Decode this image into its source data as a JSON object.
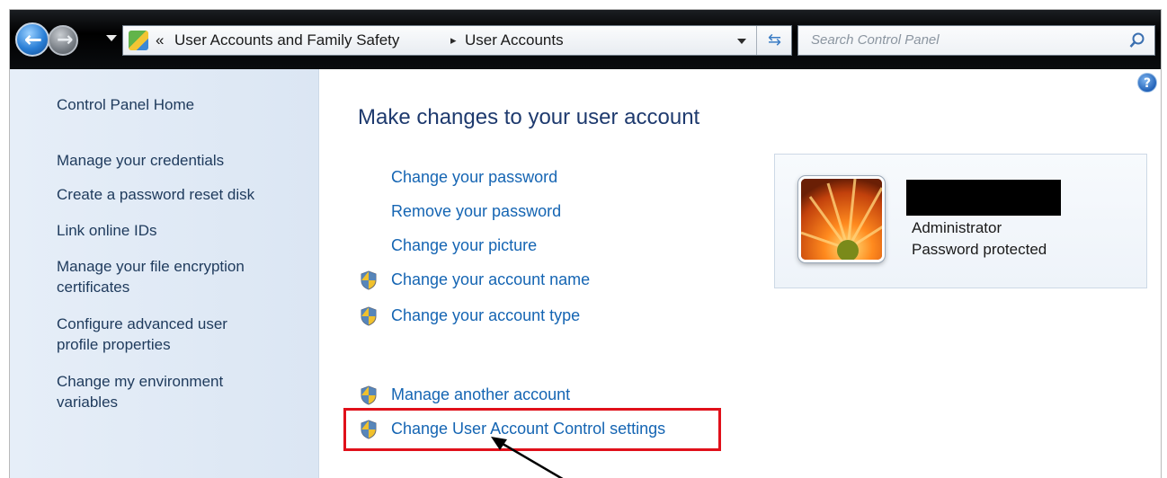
{
  "address_bar": {
    "breadcrumb_prefix": "«",
    "breadcrumb": [
      "User Accounts and Family Safety",
      "User Accounts"
    ],
    "search_placeholder": "Search Control Panel"
  },
  "left_pane": {
    "items": [
      {
        "label": "Control Panel Home"
      },
      {
        "label": "Manage your credentials"
      },
      {
        "label": "Create a password reset disk"
      },
      {
        "label": "Link online IDs"
      },
      {
        "label": "Manage your file encryption certificates"
      },
      {
        "label": "Configure advanced user profile properties"
      },
      {
        "label": "Change my environment variables"
      }
    ]
  },
  "main": {
    "title": "Make changes to your user account",
    "tasks": [
      {
        "label": "Change your password",
        "shield": false
      },
      {
        "label": "Remove your password",
        "shield": false
      },
      {
        "label": "Change your picture",
        "shield": false
      },
      {
        "label": "Change your account name",
        "shield": true
      },
      {
        "label": "Change your account type",
        "shield": true
      },
      {
        "label": "Manage another account",
        "shield": true
      },
      {
        "label": "Change User Account Control settings",
        "shield": true
      }
    ]
  },
  "user_card": {
    "account_type": "Administrator",
    "password_status": "Password protected"
  },
  "help_icon": "help-icon",
  "colors": {
    "link": "#1565b3",
    "title": "#1e3a6e",
    "highlight": "#e0101a",
    "left_pane_bg": "#e6eef8"
  }
}
